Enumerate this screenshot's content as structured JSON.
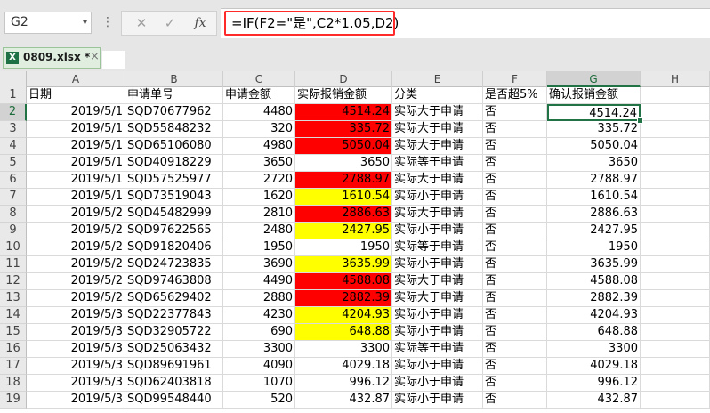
{
  "formula_bar": {
    "name_box": "G2",
    "name_box_arrow": "▾",
    "menu_glyph": "⋮",
    "cancel_glyph": "✕",
    "enter_glyph": "✓",
    "fx_label": "fx",
    "formula": "=IF(F2=\"是\",C2*1.05,D2)"
  },
  "file_tab": {
    "icon_letter": "X",
    "label": "0809.xlsx *",
    "close_glyph": "×"
  },
  "columns": [
    "A",
    "B",
    "C",
    "D",
    "E",
    "F",
    "G",
    "H"
  ],
  "active_column": "G",
  "active_row": 2,
  "header_row": [
    "日期",
    "申请单号",
    "申请金额",
    "实际报销金额",
    "分类",
    "是否超5%",
    "确认报销金额",
    ""
  ],
  "rows": [
    {
      "num": "2",
      "date": "2019/5/1",
      "id": "SQD70677962",
      "apply": "4480",
      "actual": "4514.24",
      "category": "实际大于申请",
      "over": "否",
      "confirm": "4514.24",
      "hl": "red"
    },
    {
      "num": "3",
      "date": "2019/5/1",
      "id": "SQD55848232",
      "apply": "320",
      "actual": "335.72",
      "category": "实际大于申请",
      "over": "否",
      "confirm": "335.72",
      "hl": "red"
    },
    {
      "num": "4",
      "date": "2019/5/1",
      "id": "SQD65106080",
      "apply": "4980",
      "actual": "5050.04",
      "category": "实际大于申请",
      "over": "否",
      "confirm": "5050.04",
      "hl": "red"
    },
    {
      "num": "5",
      "date": "2019/5/1",
      "id": "SQD40918229",
      "apply": "3650",
      "actual": "3650",
      "category": "实际等于申请",
      "over": "否",
      "confirm": "3650",
      "hl": "none"
    },
    {
      "num": "6",
      "date": "2019/5/1",
      "id": "SQD57525977",
      "apply": "2720",
      "actual": "2788.97",
      "category": "实际大于申请",
      "over": "否",
      "confirm": "2788.97",
      "hl": "red"
    },
    {
      "num": "7",
      "date": "2019/5/1",
      "id": "SQD73519043",
      "apply": "1620",
      "actual": "1610.54",
      "category": "实际小于申请",
      "over": "否",
      "confirm": "1610.54",
      "hl": "yellow"
    },
    {
      "num": "8",
      "date": "2019/5/2",
      "id": "SQD45482999",
      "apply": "2810",
      "actual": "2886.63",
      "category": "实际大于申请",
      "over": "否",
      "confirm": "2886.63",
      "hl": "red"
    },
    {
      "num": "9",
      "date": "2019/5/2",
      "id": "SQD97622565",
      "apply": "2480",
      "actual": "2427.95",
      "category": "实际小于申请",
      "over": "否",
      "confirm": "2427.95",
      "hl": "yellow"
    },
    {
      "num": "10",
      "date": "2019/5/2",
      "id": "SQD91820406",
      "apply": "1950",
      "actual": "1950",
      "category": "实际等于申请",
      "over": "否",
      "confirm": "1950",
      "hl": "none"
    },
    {
      "num": "11",
      "date": "2019/5/2",
      "id": "SQD24723835",
      "apply": "3690",
      "actual": "3635.99",
      "category": "实际小于申请",
      "over": "否",
      "confirm": "3635.99",
      "hl": "yellow"
    },
    {
      "num": "12",
      "date": "2019/5/2",
      "id": "SQD97463808",
      "apply": "4490",
      "actual": "4588.08",
      "category": "实际大于申请",
      "over": "否",
      "confirm": "4588.08",
      "hl": "red"
    },
    {
      "num": "13",
      "date": "2019/5/2",
      "id": "SQD65629402",
      "apply": "2880",
      "actual": "2882.39",
      "category": "实际大于申请",
      "over": "否",
      "confirm": "2882.39",
      "hl": "red"
    },
    {
      "num": "14",
      "date": "2019/5/3",
      "id": "SQD22377843",
      "apply": "4230",
      "actual": "4204.93",
      "category": "实际小于申请",
      "over": "否",
      "confirm": "4204.93",
      "hl": "yellow"
    },
    {
      "num": "15",
      "date": "2019/5/3",
      "id": "SQD32905722",
      "apply": "690",
      "actual": "648.88",
      "category": "实际小于申请",
      "over": "否",
      "confirm": "648.88",
      "hl": "yellow"
    },
    {
      "num": "16",
      "date": "2019/5/3",
      "id": "SQD25063432",
      "apply": "3300",
      "actual": "3300",
      "category": "实际等于申请",
      "over": "否",
      "confirm": "3300",
      "hl": "none"
    },
    {
      "num": "17",
      "date": "2019/5/3",
      "id": "SQD89691961",
      "apply": "4090",
      "actual": "4029.18",
      "category": "实际小于申请",
      "over": "否",
      "confirm": "4029.18",
      "hl": "none"
    },
    {
      "num": "18",
      "date": "2019/5/3",
      "id": "SQD62403818",
      "apply": "1070",
      "actual": "996.12",
      "category": "实际小于申请",
      "over": "否",
      "confirm": "996.12",
      "hl": "none"
    },
    {
      "num": "19",
      "date": "2019/5/3",
      "id": "SQD99548440",
      "apply": "520",
      "actual": "432.87",
      "category": "实际小于申请",
      "over": "否",
      "confirm": "432.87",
      "hl": "none"
    }
  ],
  "colors": {
    "highlight_red": "#ff0000",
    "highlight_yellow": "#ffff00",
    "selection_green": "#217346",
    "formula_box_border": "#ff2b2b"
  }
}
